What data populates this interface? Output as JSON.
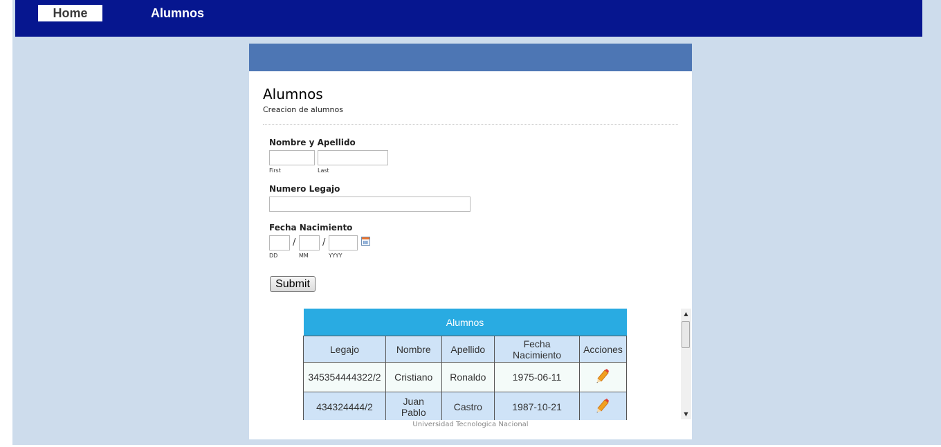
{
  "nav": {
    "home_label": "Home",
    "alumnos_label": "Alumnos"
  },
  "form": {
    "title": "Alumnos",
    "subtitle": "Creacion de alumnos",
    "name_label": "Nombre y Apellido",
    "first_sub": "First",
    "last_sub": "Last",
    "first_value": "",
    "last_value": "",
    "legajo_label": "Numero Legajo",
    "legajo_value": "",
    "birth_label": "Fecha Nacimiento",
    "dd_sub": "DD",
    "mm_sub": "MM",
    "yyyy_sub": "YYYY",
    "date_sep": "/",
    "submit_label": "Submit"
  },
  "table": {
    "caption": "Alumnos",
    "headers": [
      "Legajo",
      "Nombre",
      "Apellido",
      "Fecha Nacimiento",
      "Acciones"
    ],
    "rows": [
      [
        "345354444322/2",
        "Cristiano",
        "Ronaldo",
        "1975-06-11"
      ],
      [
        "434324444/2",
        "Juan Pablo",
        "Castro",
        "1987-10-21"
      ]
    ],
    "action_icon": "pencil-icon"
  },
  "footer": "Universidad Tecnologica Nacional",
  "colors": {
    "topbar": "#06168f",
    "page_bg": "#cddcec",
    "card_header": "#4d76b4",
    "table_caption": "#29abe2",
    "table_header": "#cfe3f7"
  }
}
